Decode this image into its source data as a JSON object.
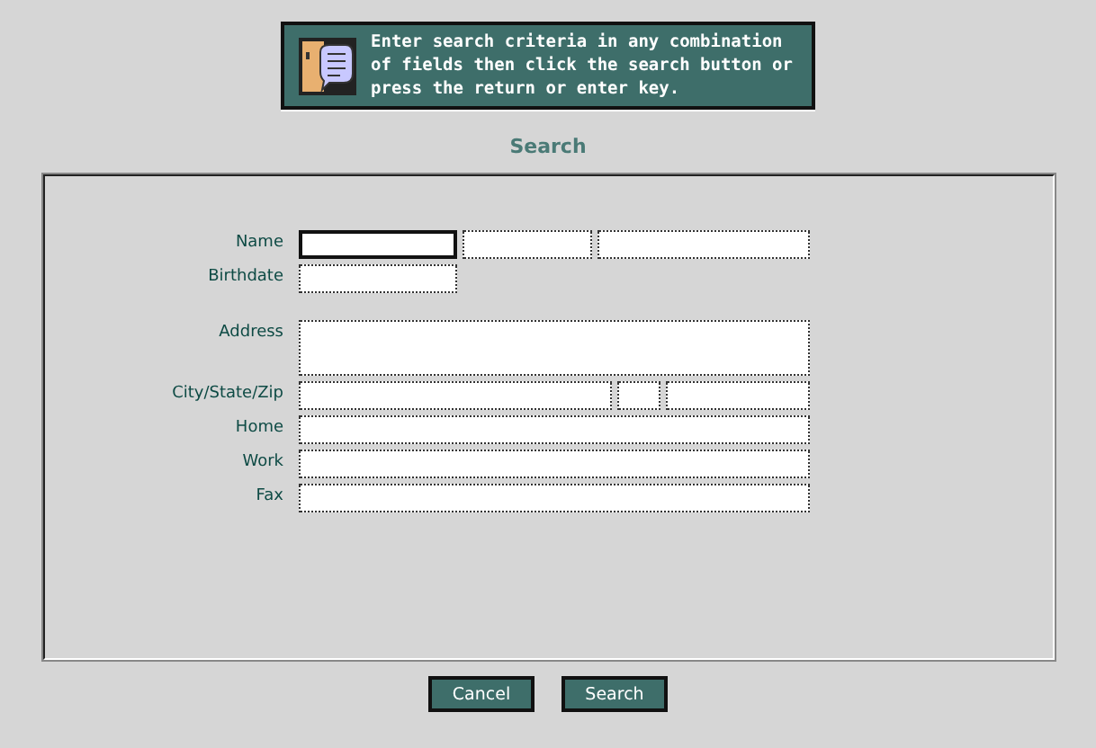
{
  "banner": {
    "text": "Enter search criteria in any combination of fields then click the search button or press the return or enter key."
  },
  "title": "Search",
  "form": {
    "rows": [
      {
        "label": "Name",
        "kind": "line",
        "fields": [
          {
            "focused": true
          },
          {
            "focused": false
          },
          {
            "focused": false
          }
        ]
      },
      {
        "label": "Birthdate",
        "kind": "line",
        "fields": [
          {
            "focused": false
          }
        ]
      },
      {
        "label": "Address",
        "kind": "area",
        "fields": [
          {
            "focused": false
          }
        ]
      },
      {
        "label": "City/State/Zip",
        "kind": "line",
        "fields": [
          {
            "focused": false
          },
          {
            "focused": false
          },
          {
            "focused": false
          }
        ]
      },
      {
        "label": "Home",
        "kind": "line",
        "fields": [
          {
            "focused": false
          }
        ]
      },
      {
        "label": "Work",
        "kind": "line",
        "fields": [
          {
            "focused": false
          }
        ]
      },
      {
        "label": "Fax",
        "kind": "line",
        "fields": [
          {
            "focused": false
          }
        ]
      }
    ]
  },
  "buttons": [
    "Cancel",
    "Search"
  ]
}
